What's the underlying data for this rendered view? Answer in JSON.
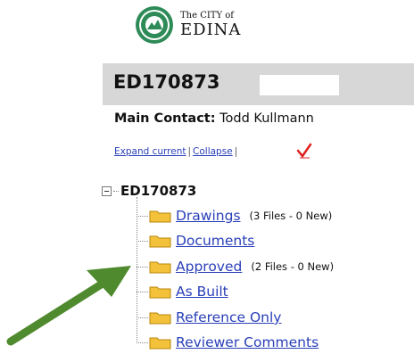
{
  "logo": {
    "line1": "The CITY of",
    "line2": "EDINA"
  },
  "project": {
    "id": "ED170873"
  },
  "contact": {
    "label": "Main Contact:",
    "name": "Todd Kullmann"
  },
  "links": {
    "expand": "Expand current",
    "separator": "|",
    "collapse": "Collapse"
  },
  "tree": {
    "root": "ED170873",
    "items": [
      {
        "label": "Drawings",
        "meta": "(3 Files - 0 New)"
      },
      {
        "label": "Documents",
        "meta": ""
      },
      {
        "label": "Approved",
        "meta": "(2 Files - 0 New)"
      },
      {
        "label": "As Built",
        "meta": ""
      },
      {
        "label": "Reference Only",
        "meta": ""
      },
      {
        "label": "Reviewer Comments",
        "meta": ""
      }
    ]
  },
  "colors": {
    "link": "#2a40b8",
    "header_bar": "#d7d7d7",
    "folder": "#f3c23a",
    "check": "#e0201c",
    "arrow": "#4f8a2e",
    "seal": "#2e8b57"
  },
  "icons": {
    "seal": "city-seal-icon",
    "folder": "folder-icon",
    "check": "checkmark-icon",
    "collapse": "minus-box-icon",
    "arrow": "arrow-icon"
  }
}
